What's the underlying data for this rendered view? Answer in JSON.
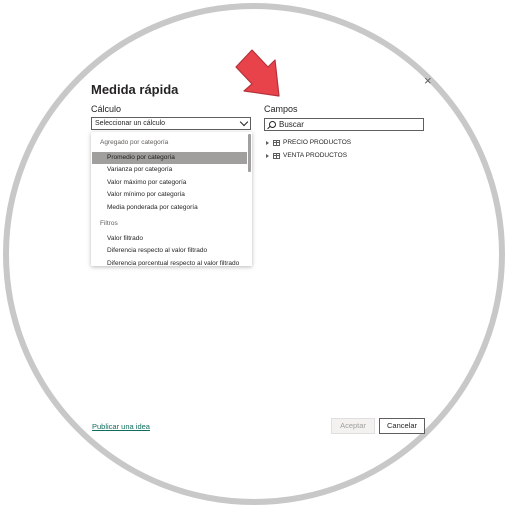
{
  "dialog": {
    "title": "Medida rápida",
    "close_label": "×"
  },
  "calculation": {
    "label": "Cálculo",
    "select_value": "Seleccionar un cálculo",
    "groups": [
      {
        "name": "Agregado por categoría",
        "items": [
          {
            "label": "Promedio por categoría",
            "selected": true
          },
          {
            "label": "Varianza por categoría"
          },
          {
            "label": "Valor máximo por categoría"
          },
          {
            "label": "Valor mínimo por categoría"
          },
          {
            "label": "Media ponderada por categoría"
          }
        ]
      },
      {
        "name": "Filtros",
        "items": [
          {
            "label": "Valor filtrado"
          },
          {
            "label": "Diferencia respecto al valor filtrado"
          },
          {
            "label": "Diferencia porcentual respecto al valor filtrado"
          }
        ]
      }
    ]
  },
  "fields": {
    "label": "Campos",
    "search_placeholder": "Buscar",
    "tables": [
      {
        "name": "PRECIO PRODUCTOS",
        "icon": "table-icon"
      },
      {
        "name": "VENTA PRODUCTOS",
        "icon": "table-icon"
      }
    ]
  },
  "footer": {
    "idea_link": "Publicar una idea",
    "accept_label": "Aceptar",
    "cancel_label": "Cancelar"
  },
  "colors": {
    "arrow": "#e8424b",
    "link": "#106c5c",
    "selected_item": "#a19f9d"
  },
  "icons": {
    "annotation_arrow": "red-arrow-icon"
  }
}
